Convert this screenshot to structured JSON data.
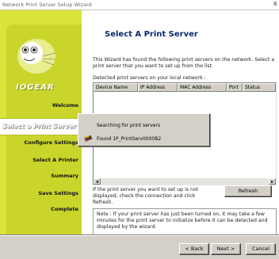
{
  "window": {
    "title": "Network Print Server Setup Wizard",
    "close_glyph": "x"
  },
  "sidebar": {
    "brand": "IOGEAR",
    "steps": [
      {
        "label": "Welcome",
        "active": false
      },
      {
        "label": "Select a Print Server",
        "active": true
      },
      {
        "label": "Configure Settings",
        "active": false
      },
      {
        "label": "Select A Printer",
        "active": false
      },
      {
        "label": "Summary",
        "active": false
      },
      {
        "label": "Save Settings",
        "active": false
      },
      {
        "label": "Complete",
        "active": false
      }
    ]
  },
  "main": {
    "heading": "Select A Print Server",
    "intro": "This Wizard has found the following print servers on the network. Select a print server that you want to set up from the list.",
    "detected_label": "Detected print servers on your local network :",
    "columns": [
      "Device Name",
      "IP Address",
      "MAC Address",
      "Port",
      "Status"
    ],
    "scroll_left": "◂",
    "scroll_right": "▸",
    "popup": {
      "searching": "Searching for print servers",
      "found": "Found 1P_PrintServ0000B2"
    },
    "hint": "If the print server you want to set up is not displayed, check the connection and click Refresh.",
    "refresh_label": "Refresh",
    "note": "Note : If your print server has just been turned on, it may take a few minutes for the print server to initialize before it can be detected and displayed by the wizard."
  },
  "footer": {
    "back_label": "< Back",
    "next_label": "Next >",
    "cancel_label": "Cancel"
  },
  "colors": {
    "sidebar": "#d9e43a",
    "heading": "#0a2a70"
  }
}
